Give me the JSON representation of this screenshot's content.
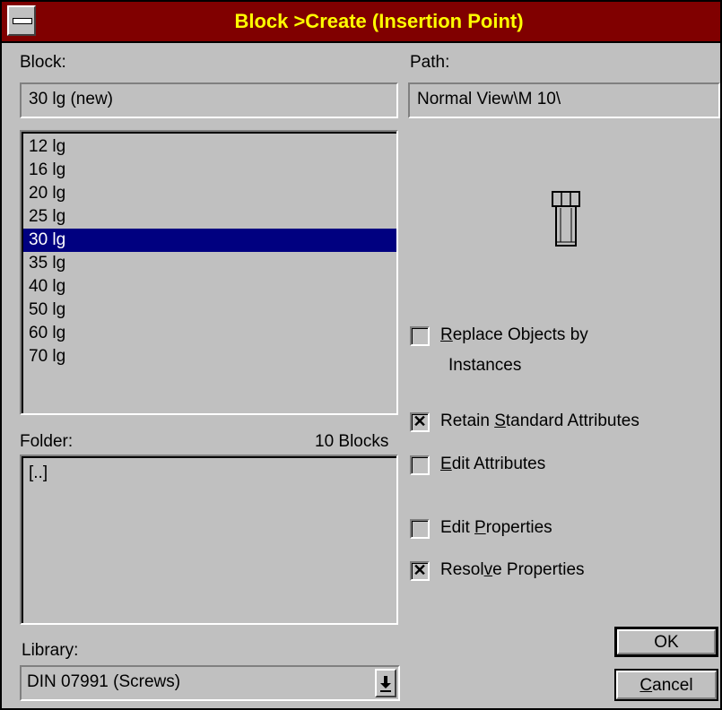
{
  "window": {
    "title": "Block >Create (Insertion Point)"
  },
  "block": {
    "label": "Block:",
    "value": "30 lg (new)"
  },
  "path": {
    "label": "Path:",
    "value": "Normal View\\M 10\\"
  },
  "block_list": {
    "items": [
      "12 lg",
      "16 lg",
      "20 lg",
      "25 lg",
      "30 lg",
      "35 lg",
      "40 lg",
      "50 lg",
      "60 lg",
      "70 lg"
    ],
    "selected_index": 4
  },
  "folder": {
    "label": "Folder:",
    "count": "10 Blocks",
    "items": [
      "[..]"
    ]
  },
  "library": {
    "label": "Library:",
    "value": "DIN 07991 (Screws)"
  },
  "options": {
    "replace_objects": {
      "label_pre": "",
      "accel": "R",
      "label_post": "eplace Objects by",
      "label_line2": "Instances",
      "checked": false
    },
    "retain_standard": {
      "label_pre": "Retain ",
      "accel": "S",
      "label_post": "tandard Attributes",
      "checked": true
    },
    "edit_attributes": {
      "label_pre": "",
      "accel": "E",
      "label_post": "dit Attributes",
      "checked": false
    },
    "edit_properties": {
      "label_pre": "Edit ",
      "accel": "P",
      "label_post": "roperties",
      "checked": false
    },
    "resolve_properties": {
      "label_pre": "Resol",
      "accel": "v",
      "label_post": "e Properties",
      "checked": true
    }
  },
  "buttons": {
    "ok": "OK",
    "cancel_accel": "C",
    "cancel_rest": "ancel"
  },
  "icons": {
    "preview": "screw-preview-icon",
    "check_mark": "✕",
    "dropdown_arrow": "⇩"
  }
}
